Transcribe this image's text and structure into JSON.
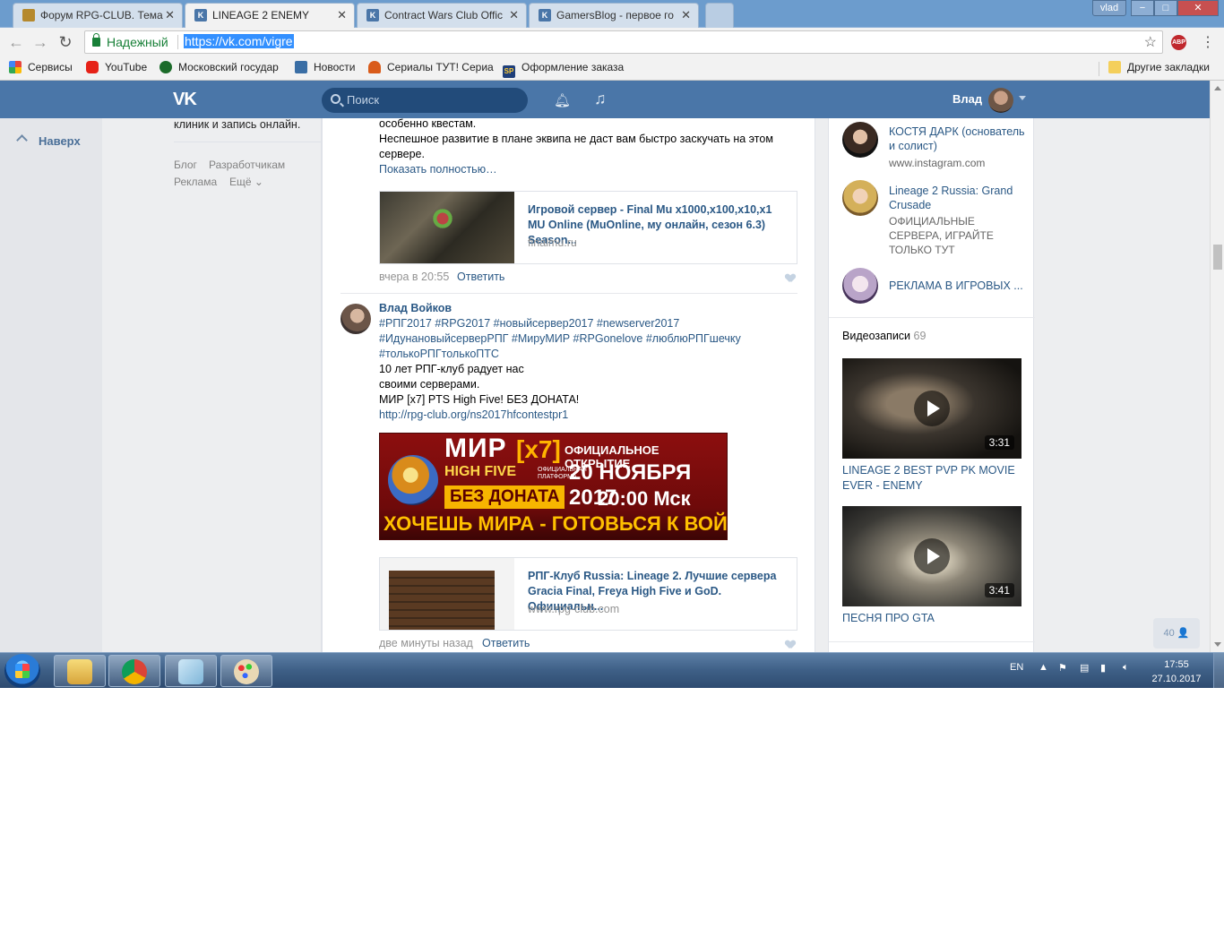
{
  "chrome": {
    "tabs": [
      {
        "title": "Форум RPG-CLUB. Тема",
        "active": false
      },
      {
        "title": "LINEAGE 2 ENEMY",
        "active": true
      },
      {
        "title": "Contract Wars Club Offic",
        "active": false
      },
      {
        "title": "GamersBlog - первое го",
        "active": false
      }
    ],
    "profile_chip": "vlad",
    "win_min": "−",
    "win_max": "□",
    "win_close": "✕",
    "secure_label": "Надежный",
    "url": "https://vk.com/vigre",
    "abp_badge": "ABP",
    "abp_count": "1",
    "bookmarks": [
      {
        "label": "Сервисы",
        "color": "#e8453c"
      },
      {
        "label": "YouTube",
        "color": "#e62117"
      },
      {
        "label": "Московский государ",
        "color": "#1b6b2a"
      },
      {
        "label": "Новости",
        "color": "#3a6ea5"
      },
      {
        "label": "Сериалы ТУТ! Сериа",
        "color": "#d95b1a"
      },
      {
        "label": "Оформление заказа",
        "color": "#1f3f7a"
      }
    ],
    "other_bookmarks": "Другие закладки"
  },
  "vk": {
    "search_placeholder": "Поиск",
    "user_name": "Влад",
    "back_to_top": "Наверх",
    "left": {
      "clipped_text": "клиник и запись онлайн.",
      "footer_links": [
        "Блог",
        "Разработчикам",
        "Реклама",
        "Ещё ⌄"
      ]
    },
    "feed": {
      "post1": {
        "line1": "особенно квестам.",
        "line2": "Неспешное развитие в плане эквипа не даст вам быстро заскучать на этом",
        "line3": "сервере.",
        "show_more": "Показать полностью…",
        "card_title": "Игровой сервер - Final Mu x1000,x100,x10,x1 MU Online (MuOnline, му онлайн, сезон 6.3) Season...",
        "card_domain": "finalmu.ru",
        "time": "вчера в 20:55",
        "reply": "Ответить"
      },
      "post2": {
        "author": "Влад Войков",
        "hashtags1": "#РПГ2017 #RPG2017 #новыйсервер2017 #newserver2017",
        "hashtags2": "#ИдунановыйсерверРПГ #МируМИР #RPGonelove #люблюРПГшечку",
        "hashtags3": "#толькоРПГтолькоПТС",
        "text1": "10 лет РПГ-клуб радует нас",
        "text2": "своими серверами.",
        "text3": "МИР [x7] PTS High Five! БЕЗ ДОНАТА!",
        "link": "http://rpg-club.org/ns2017hfcontestpr1",
        "banner": {
          "mir": "МИР",
          "x7": "[x7]",
          "high_five": "HIGH FIVE",
          "platform": "ОФИЦИАЛЬНАЯ ПЛАТФОРМА",
          "no_donate": "БЕЗ ДОНАТА",
          "official_open": "ОФИЦИАЛЬНОЕ ОТКРЫТИЕ",
          "date": "20 НОЯБРЯ 2017",
          "time": "20:00 Мск",
          "slogan": "ХОЧЕШЬ МИРА - ГОТОВЬСЯ К ВОЙНЕ"
        },
        "card_title": "РПГ-Клуб Russia: Lineage 2. Лучшие сервера Gracia Final, Freya High Five и GoD. Официальн...",
        "card_domain": "www.rpg-club.com",
        "time": "две минуты назад",
        "reply": "Ответить"
      }
    },
    "right": {
      "contacts": [
        {
          "name": "КОСТЯ ДАРК (основатель и солист)",
          "sub": "www.instagram.com"
        },
        {
          "name": "Lineage 2 Russia: Grand Crusade",
          "sub": "ОФИЦИАЛЬНЫЕ СЕРВЕРА, ИГРАЙТЕ ТОЛЬКО ТУТ"
        },
        {
          "name": "РЕКЛАМА В ИГРОВЫХ ...",
          "sub": ""
        }
      ],
      "videos_label": "Видеозаписи",
      "videos_count": "69",
      "videos": [
        {
          "title": "LINEAGE 2 BEST PVP PK MOVIE EVER - ENEMY",
          "duration": "3:31"
        },
        {
          "title": "ПЕСНЯ ПРО GTA",
          "duration": "3:41"
        }
      ]
    },
    "online_counter": "40 👤"
  },
  "taskbar": {
    "lang": "EN",
    "time": "17:55",
    "date": "27.10.2017"
  }
}
